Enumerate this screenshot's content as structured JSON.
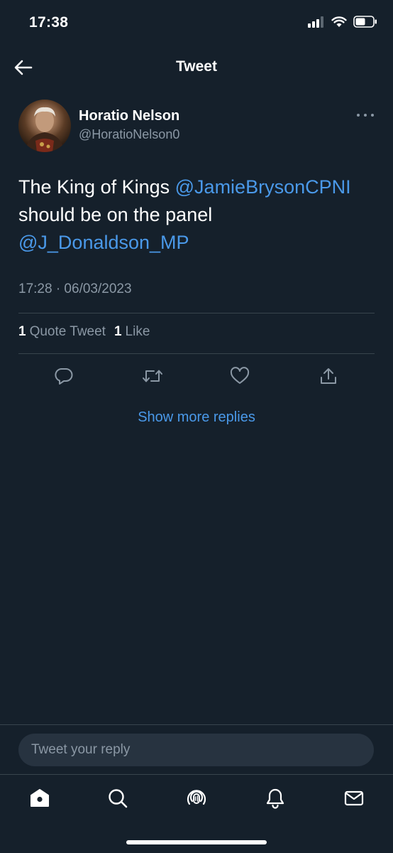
{
  "status_bar": {
    "time": "17:38",
    "icons": [
      "cellular-signal-icon",
      "wifi-icon",
      "battery-icon"
    ]
  },
  "nav": {
    "title": "Tweet",
    "back_icon": "back-arrow-icon"
  },
  "tweet": {
    "author": {
      "name": "Horatio Nelson",
      "handle": "@HoratioNelson0",
      "avatar": "portrait-avatar"
    },
    "text_parts": {
      "part1": "The King of Kings ",
      "mention1": "@JamieBrysonCPNI",
      "part2": "should be on the panel",
      "mention2": "@J_Donaldson_MP"
    },
    "timestamp": "17:28 · 06/03/2023",
    "stats": {
      "quote_count": "1",
      "quote_label": "Quote Tweet",
      "like_count": "1",
      "like_label": "Like"
    },
    "actions": [
      "reply-icon",
      "retweet-icon",
      "like-icon",
      "share-icon"
    ]
  },
  "show_more_replies": "Show more replies",
  "reply": {
    "placeholder": "Tweet your reply"
  },
  "tab_bar": {
    "tabs": [
      "home-icon",
      "search-icon",
      "spaces-icon",
      "notifications-icon",
      "messages-icon"
    ]
  },
  "colors": {
    "background": "#15202b",
    "accent": "#4a99e9",
    "secondary_text": "#8b98a5",
    "divider": "#38444d"
  }
}
